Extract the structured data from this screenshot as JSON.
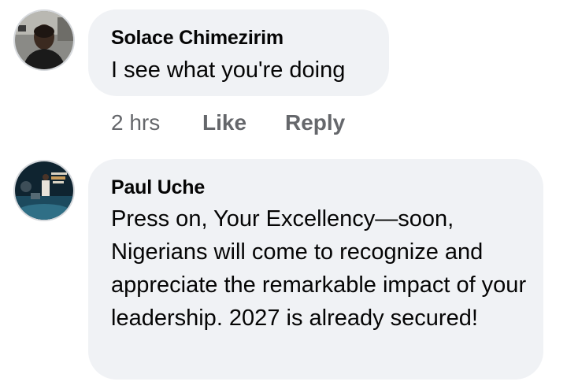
{
  "comments": [
    {
      "author": "Solace Chimezirim",
      "text": "I see what you're doing",
      "time": "2 hrs",
      "like_label": "Like",
      "reply_label": "Reply"
    },
    {
      "author": "Paul Uche",
      "text": "Press on, Your Excellency—soon, Nigerians will come to recognize and appreciate the remarkable impact of your leadership. 2027 is already secured!"
    }
  ],
  "colors": {
    "bubble": "#f0f2f5",
    "author_text": "#050505",
    "meta_text": "#65676b"
  },
  "icons": {
    "avatar_1": "person-photo-avatar",
    "avatar_2": "poster-photo-avatar"
  }
}
